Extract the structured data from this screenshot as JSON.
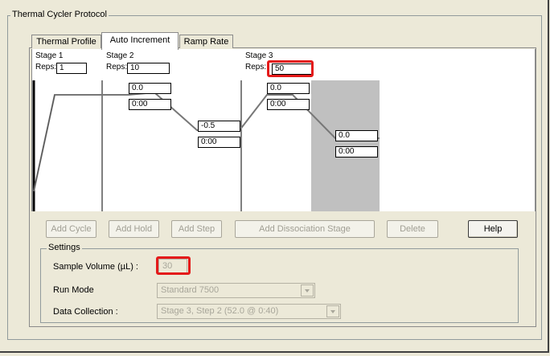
{
  "window": {
    "group_title": "Thermal Cycler Protocol"
  },
  "tabs": [
    {
      "label": "Thermal Profile",
      "active": false
    },
    {
      "label": "Auto Increment",
      "active": true
    },
    {
      "label": "Ramp Rate",
      "active": false
    }
  ],
  "profile": {
    "stages": [
      {
        "label": "Stage 1",
        "reps_label": "Reps:",
        "reps": "1"
      },
      {
        "label": "Stage 2",
        "reps_label": "Reps:",
        "reps": "10"
      },
      {
        "label": "Stage 3",
        "reps_label": "Reps:",
        "reps": "50"
      }
    ],
    "steps": [
      {
        "temp": "0.0",
        "time": "0:00"
      },
      {
        "temp": "-0.5",
        "time": "0:00"
      },
      {
        "temp": "0.0",
        "time": "0:00"
      },
      {
        "temp": "0.0",
        "time": "0:00"
      }
    ]
  },
  "buttons": {
    "add_cycle": "Add Cycle",
    "add_hold": "Add Hold",
    "add_step": "Add Step",
    "add_dissociation": "Add Dissociation Stage",
    "delete": "Delete",
    "help": "Help"
  },
  "settings": {
    "title": "Settings",
    "sample_volume_label": "Sample Volume (µL) :",
    "sample_volume": "30",
    "run_mode_label": "Run Mode",
    "run_mode": "Standard 7500",
    "data_collection_label": "Data Collection :",
    "data_collection": "Stage 3, Step 2 (52.0 @ 0:40)"
  },
  "colors": {
    "highlight": "#e41a1a",
    "selected_step": "#c0c0c0",
    "window_bg": "#ece9d8"
  }
}
